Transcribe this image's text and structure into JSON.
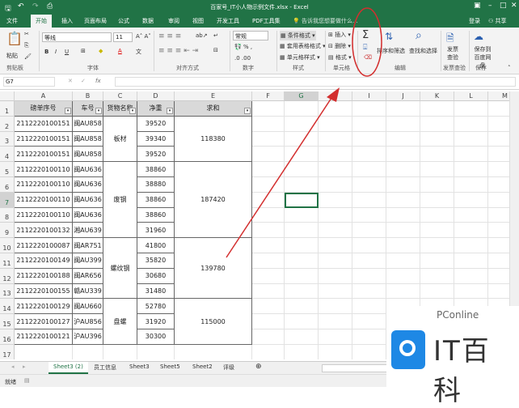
{
  "window": {
    "title": "百家号_IT小人物示例文件.xlsx - Excel"
  },
  "tabs": [
    "文件",
    "开始",
    "插入",
    "页面布局",
    "公式",
    "数据",
    "审阅",
    "视图",
    "开发工具",
    "PDF工具集"
  ],
  "tell_me": "告诉我您想要做什么...",
  "account": {
    "login": "登录",
    "share": "共享"
  },
  "ribbon": {
    "clipboard": {
      "paste": "粘贴",
      "group": "剪贴板"
    },
    "font": {
      "name": "等线",
      "size": "11",
      "group": "字体"
    },
    "align": {
      "group": "对齐方式"
    },
    "number": {
      "format": "常规",
      "group": "数字"
    },
    "styles": {
      "cond": "条件格式",
      "table": "套用表格格式",
      "cell": "单元格样式",
      "group": "样式"
    },
    "cells": {
      "insert": "插入",
      "delete": "删除",
      "format": "格式",
      "group": "单元格"
    },
    "editing": {
      "sort": "排序和筛选",
      "find": "查找和选择",
      "group": "编辑"
    },
    "invoice": {
      "label": "发票查验",
      "group": "发票查验"
    },
    "save": {
      "label": "保存到百度网盘",
      "group": "保存"
    }
  },
  "formula_bar": {
    "name_box": "G7",
    "fx": "fx",
    "value": ""
  },
  "columns": [
    "A",
    "B",
    "C",
    "D",
    "E",
    "F",
    "G",
    "H",
    "I",
    "J",
    "K",
    "L",
    "M"
  ],
  "headers": [
    "磅单序号",
    "车号",
    "货物名称",
    "净重",
    "求和"
  ],
  "rows": [
    [
      "2112220100151",
      "闽AU858",
      "39520"
    ],
    [
      "2112220100151",
      "闽AU858",
      "39340"
    ],
    [
      "2112220100151",
      "闽AU858",
      "39520"
    ],
    [
      "2112220100110",
      "闽AU636",
      "38860"
    ],
    [
      "2112220100110",
      "闽AU636",
      "38880"
    ],
    [
      "2112220100110",
      "闽AU636",
      "38860"
    ],
    [
      "2112220100110",
      "闽AU636",
      "38860"
    ],
    [
      "2112220100132",
      "湘AU639",
      "31960"
    ],
    [
      "2112220100087",
      "闽AR751",
      "41800"
    ],
    [
      "2112220100149",
      "闽AU399",
      "35820"
    ],
    [
      "2112220100188",
      "闽AR656",
      "30680"
    ],
    [
      "2112220100155",
      "赣AU339",
      "31480"
    ],
    [
      "2112220100129",
      "闽AU660",
      "52780"
    ],
    [
      "2112220100127",
      "沪AU856",
      "31920"
    ],
    [
      "2112220100121",
      "沪AU396",
      "30300"
    ]
  ],
  "groups": [
    {
      "name": "板材",
      "start": 0,
      "span": 3,
      "sum": "118380"
    },
    {
      "name": "废钢",
      "start": 3,
      "span": 5,
      "sum": "187420"
    },
    {
      "name": "螺纹钢",
      "start": 8,
      "span": 4,
      "sum": "139780"
    },
    {
      "name": "盘螺",
      "start": 12,
      "span": 3,
      "sum": "115000"
    }
  ],
  "sheets": [
    "Sheet3 (2)",
    "员工信息",
    "Sheet3",
    "Sheet5",
    "Sheet2",
    "评级"
  ],
  "status": "就绪",
  "watermark": {
    "brand": "PConline",
    "name": "IT百科"
  },
  "colors": {
    "accent": "#217346",
    "annotation": "#d32f2f"
  }
}
